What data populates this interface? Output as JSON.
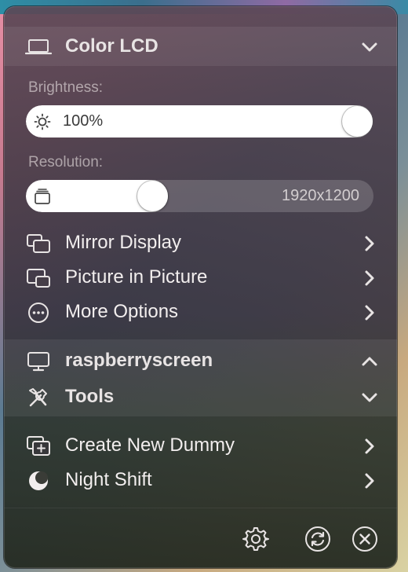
{
  "display_section": {
    "title": "Color LCD",
    "icon": "laptop-icon",
    "expanded": true,
    "brightness": {
      "label": "Brightness:",
      "value_text": "100%",
      "level": 1.0,
      "icon": "sun-icon"
    },
    "resolution": {
      "label": "Resolution:",
      "value_text": "1920x1200",
      "level": 0.35,
      "icon": "resolution-stack-icon"
    },
    "items": [
      {
        "label": "Mirror Display",
        "icon": "mirror-display-icon"
      },
      {
        "label": "Picture in Picture",
        "icon": "picture-in-picture-icon"
      },
      {
        "label": "More Options",
        "icon": "ellipsis-circle-icon"
      }
    ]
  },
  "collapsed_sections": [
    {
      "label": "raspberryscreen",
      "icon": "monitor-icon",
      "chevron": "up"
    },
    {
      "label": "Tools",
      "icon": "tools-icon",
      "chevron": "down"
    }
  ],
  "tools_items": [
    {
      "label": "Create New Dummy",
      "icon": "add-display-icon"
    },
    {
      "label": "Night Shift",
      "icon": "moon-icon"
    }
  ],
  "footer": {
    "buttons": [
      "gear-icon",
      "refresh-icon",
      "close-icon"
    ]
  },
  "colors": {
    "text": "#f2eeee",
    "slider_fill": "#ffffff",
    "slider_track": "#6b5f6a"
  }
}
